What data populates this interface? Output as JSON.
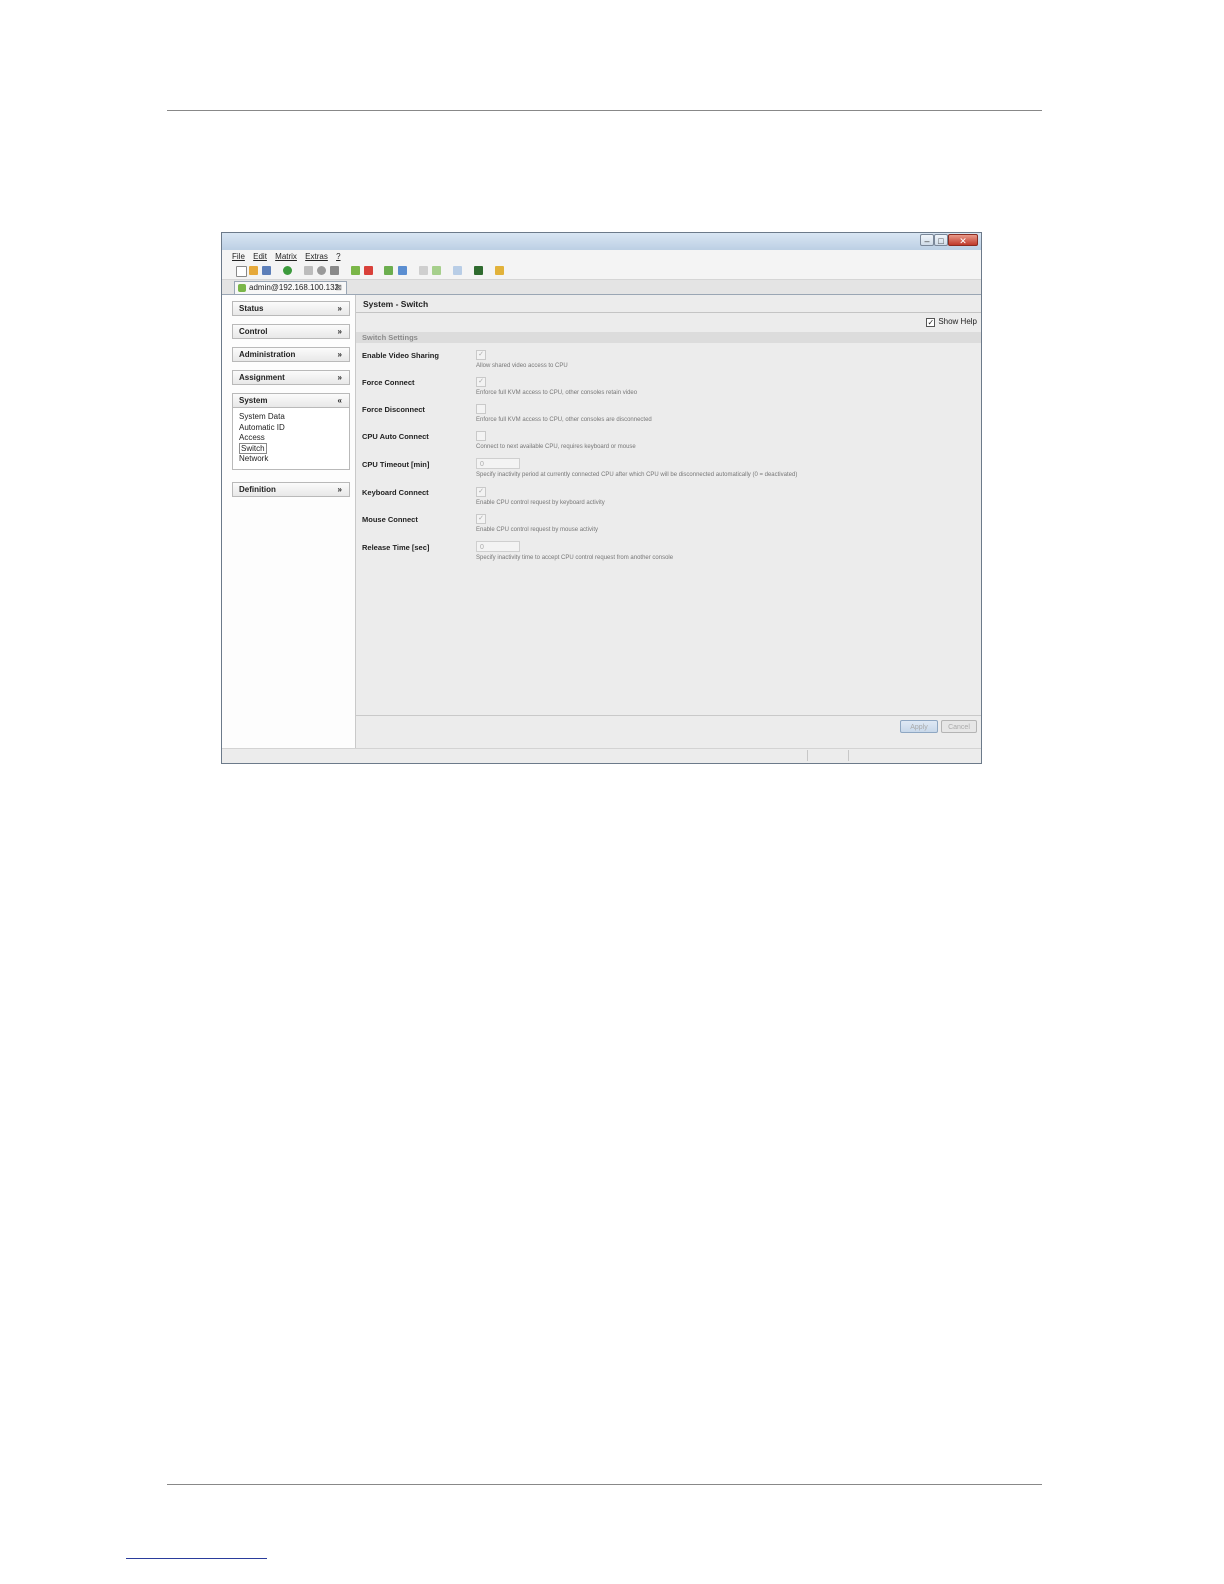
{
  "window": {
    "menu": [
      "File",
      "Edit",
      "Matrix",
      "Extras",
      "?"
    ],
    "tab_label": "admin@192.168.100.132"
  },
  "sidebar": {
    "sections": [
      {
        "label": "Status"
      },
      {
        "label": "Control"
      },
      {
        "label": "Administration"
      },
      {
        "label": "Assignment"
      },
      {
        "label": "System"
      },
      {
        "label": "Definition"
      }
    ],
    "system_items": [
      "System Data",
      "Automatic ID",
      "Access",
      "Switch",
      "Network"
    ],
    "selected_item": "Switch"
  },
  "main": {
    "title": "System - Switch",
    "show_help_label": "Show Help",
    "group_title": "Switch Settings",
    "settings": [
      {
        "label": "Enable Video Sharing",
        "help": "Allow shared video access to CPU",
        "type": "checkbox"
      },
      {
        "label": "Force Connect",
        "help": "Enforce full KVM access to CPU, other consoles retain video",
        "type": "checkbox"
      },
      {
        "label": "Force Disconnect",
        "help": "Enforce full KVM access to CPU, other consoles are disconnected",
        "type": "checkbox"
      },
      {
        "label": "CPU Auto Connect",
        "help": "Connect to next available CPU, requires keyboard or mouse",
        "type": "checkbox"
      },
      {
        "label": "CPU Timeout [min]",
        "help": "Specify inactivity period at currently connected CPU after which CPU will be disconnected automatically (0 = deactivated)",
        "type": "number",
        "value": "0"
      },
      {
        "label": "Keyboard Connect",
        "help": "Enable CPU control request by keyboard activity",
        "type": "checkbox"
      },
      {
        "label": "Mouse Connect",
        "help": "Enable CPU control request by mouse activity",
        "type": "checkbox"
      },
      {
        "label": "Release Time [sec]",
        "help": "Specify inactivity time to accept CPU control request from another console",
        "type": "number",
        "value": "0"
      }
    ],
    "apply_label": "Apply",
    "cancel_label": "Cancel"
  }
}
